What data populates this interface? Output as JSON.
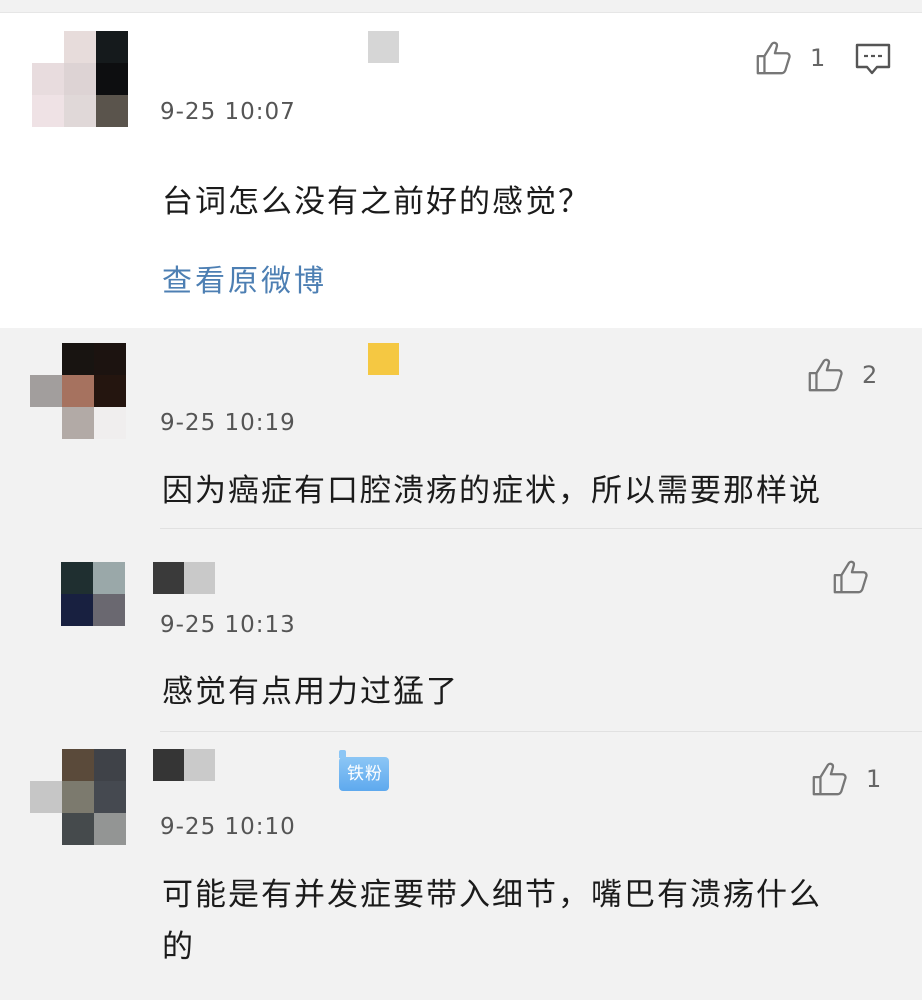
{
  "comments": [
    {
      "time": "9-25 10:07",
      "text": "台词怎么没有之前好的感觉？",
      "likes": "1",
      "view_original": "查看原微博"
    },
    {
      "time": "9-25 10:19",
      "text": "因为癌症有口腔溃疡的症状，所以需要那样说",
      "likes": "2"
    },
    {
      "time": "9-25 10:13",
      "text": "感觉有点用力过猛了",
      "likes": ""
    },
    {
      "time": "9-25 10:10",
      "text_line1": "可能是有并发症要带入细节，嘴巴有溃疡什么",
      "text_line2": "的",
      "likes": "1",
      "badge": "铁粉"
    }
  ],
  "icons": {
    "like": "thumbs-up-icon",
    "reply": "comment-bubble-icon"
  },
  "colors": {
    "link": "#4d7fb3",
    "badge": "#6fb3f0",
    "card": "#ffffff",
    "reply_bg": "#f2f2f2"
  }
}
